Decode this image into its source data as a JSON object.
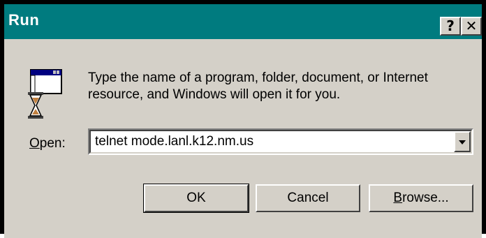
{
  "window": {
    "title": "Run",
    "help_label": "?",
    "close_label": "✕"
  },
  "message": {
    "line1": "Type the name of a program, folder, document, or Internet",
    "line2": "resource, and Windows will open it for you."
  },
  "open": {
    "label_accel": "O",
    "label_rest": "pen:",
    "value": "telnet mode.lanl.k12.nm.us"
  },
  "buttons": {
    "ok": "OK",
    "cancel": "Cancel",
    "browse_accel": "B",
    "browse_rest": "rowse..."
  },
  "colors": {
    "titlebar": "#007b7f",
    "face": "#d4d0c8"
  },
  "icons": {
    "run": "run-program-icon",
    "dropdown": "chevron-down-icon"
  }
}
